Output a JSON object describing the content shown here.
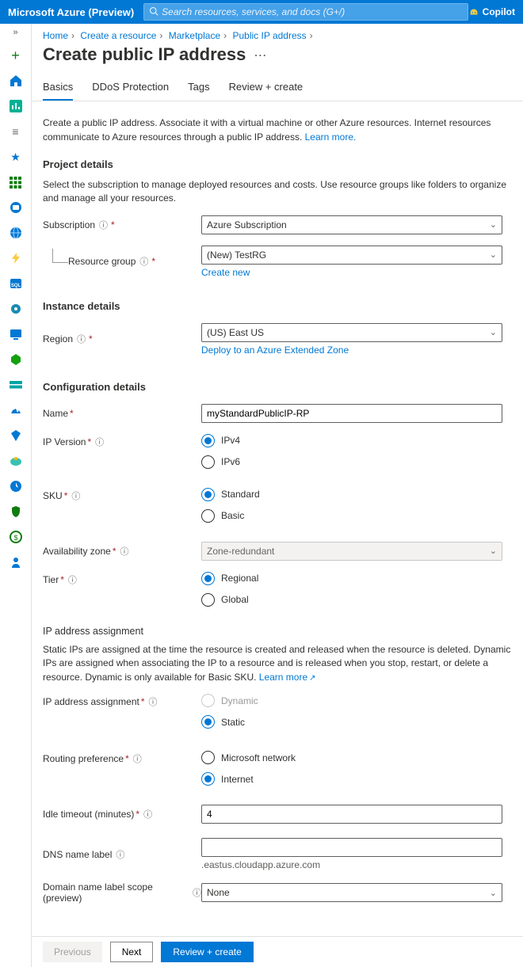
{
  "header": {
    "brand": "Microsoft Azure (Preview)",
    "search_placeholder": "Search resources, services, and docs (G+/)",
    "copilot_label": "Copilot"
  },
  "breadcrumbs": {
    "home": "Home",
    "create_resource": "Create a resource",
    "marketplace": "Marketplace",
    "pip": "Public IP address"
  },
  "page": {
    "title": "Create public IP address"
  },
  "tabs": {
    "basics": "Basics",
    "ddos": "DDoS Protection",
    "tags": "Tags",
    "review": "Review + create"
  },
  "intro": {
    "text": "Create a public IP address. Associate it with a virtual machine or other Azure resources. Internet resources communicate to Azure resources through a public IP address. ",
    "learn": "Learn more."
  },
  "project": {
    "heading": "Project details",
    "desc": "Select the subscription to manage deployed resources and costs. Use resource groups like folders to organize and manage all your resources.",
    "sub_label": "Subscription",
    "sub_value": "Azure Subscription",
    "rg_label": "Resource group",
    "rg_value": "(New) TestRG",
    "create_new": "Create new"
  },
  "instance": {
    "heading": "Instance details",
    "region_label": "Region",
    "region_value": "(US) East US",
    "ext_zone": "Deploy to an Azure Extended Zone"
  },
  "config": {
    "heading": "Configuration details",
    "name_label": "Name",
    "name_value": "myStandardPublicIP-RP",
    "ipv_label": "IP Version",
    "ipv4": "IPv4",
    "ipv6": "IPv6",
    "sku_label": "SKU",
    "sku_std": "Standard",
    "sku_basic": "Basic",
    "az_label": "Availability zone",
    "az_value": "Zone-redundant",
    "tier_label": "Tier",
    "tier_regional": "Regional",
    "tier_global": "Global",
    "assign_heading": "IP address assignment",
    "assign_text": "Static IPs are assigned at the time the resource is created and released when the resource is deleted. Dynamic IPs are assigned when associating the IP to a resource and is released when you stop, restart, or delete a resource. Dynamic is only available for Basic SKU. ",
    "assign_learn": "Learn more",
    "assign_label": "IP address assignment",
    "assign_dynamic": "Dynamic",
    "assign_static": "Static",
    "route_label": "Routing preference",
    "route_ms": "Microsoft network",
    "route_internet": "Internet",
    "idle_label": "Idle timeout (minutes)",
    "idle_value": "4",
    "dns_label": "DNS name label",
    "dns_value": "",
    "dns_suffix": ".eastus.cloudapp.azure.com",
    "scope_label": "Domain name label scope (preview)",
    "scope_value": "None"
  },
  "footer": {
    "prev": "Previous",
    "next": "Next",
    "review": "Review + create"
  }
}
